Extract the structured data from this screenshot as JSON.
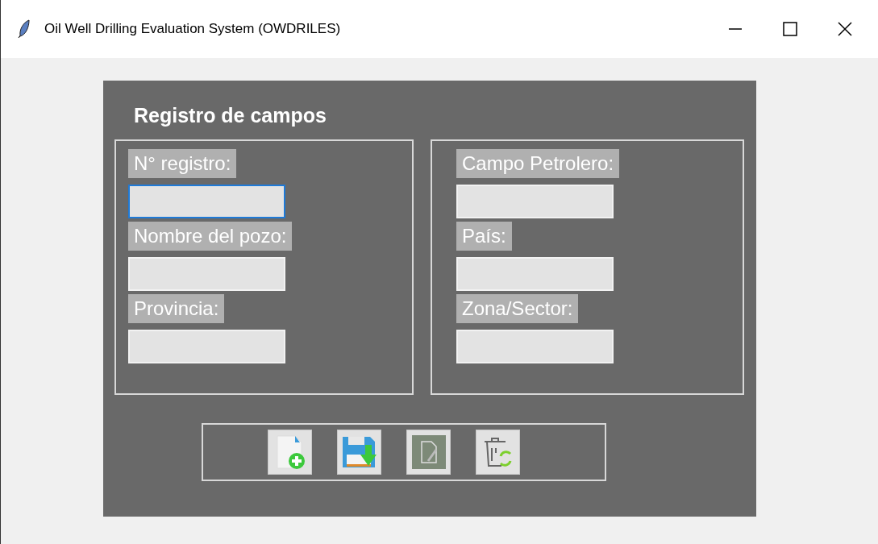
{
  "window": {
    "title": "Oil Well Drilling Evaluation System (OWDRILES)"
  },
  "form": {
    "title": "Registro de campos",
    "groups": [
      {
        "fields": [
          {
            "label": "N° registro:",
            "focused": true
          },
          {
            "label": "Nombre del pozo:",
            "focused": false
          },
          {
            "label": "Provincia:",
            "focused": false
          }
        ]
      },
      {
        "fields": [
          {
            "label": "Campo Petrolero:",
            "focused": false
          },
          {
            "label": "País:",
            "focused": false
          },
          {
            "label": "Zona/Sector:",
            "focused": false
          }
        ]
      }
    ]
  },
  "toolbar": [
    {
      "kind": "new"
    },
    {
      "kind": "save"
    },
    {
      "kind": "edit"
    },
    {
      "kind": "delete"
    }
  ]
}
